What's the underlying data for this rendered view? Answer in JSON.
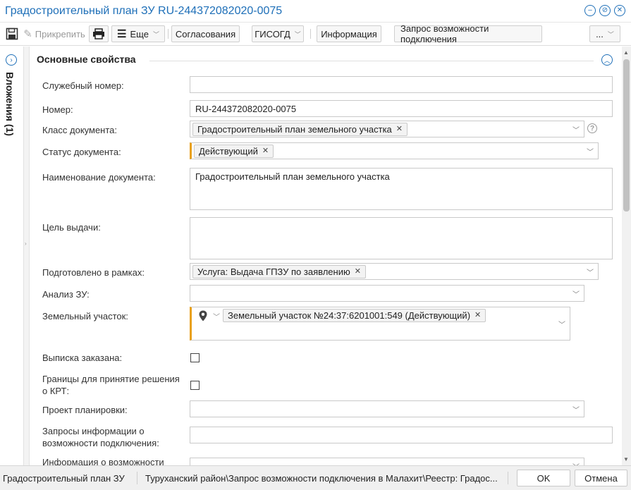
{
  "window": {
    "title": "Градостроительный план ЗУ RU-244372082020-0075",
    "buttons": [
      "minimize",
      "pin",
      "close"
    ]
  },
  "toolbar": {
    "attach_label": "Прикрепить",
    "more_label": "Еще",
    "approvals_label": "Согласования",
    "gisogd_label": "ГИСОГД",
    "info_label": "Информация",
    "connection_label": "Запрос возможности подключения",
    "overflow_label": "..."
  },
  "sidebar": {
    "label": "Вложения (1)"
  },
  "section": {
    "title": "Основные свойства"
  },
  "form": {
    "service_number": {
      "label": "Служебный номер:",
      "value": ""
    },
    "number": {
      "label": "Номер:",
      "value": "RU-244372082020-0075"
    },
    "doc_class": {
      "label": "Класс документа:",
      "tag": "Градостроительный план земельного участка"
    },
    "doc_status": {
      "label": "Статус документа:",
      "tag": "Действующий"
    },
    "doc_name": {
      "label": "Наименование документа:",
      "value": "Градостроительный план земельного участка"
    },
    "purpose": {
      "label": "Цель выдачи:",
      "value": ""
    },
    "prepared_within": {
      "label": "Подготовлено в рамках:",
      "tag": "Услуга: Выдача ГПЗУ по заявлению"
    },
    "analysis": {
      "label": "Анализ ЗУ:",
      "value": ""
    },
    "land_plot": {
      "label": "Земельный участок:",
      "tag": "Земельный участок №24:37:6201001:549 (Действующий)"
    },
    "extract_ordered": {
      "label": "Выписка заказана:",
      "checked": false
    },
    "krt_boundaries": {
      "label": "Границы для принятие решения о КРТ:",
      "checked": false
    },
    "planning_project": {
      "label": "Проект планировки:",
      "value": ""
    },
    "connection_requests": {
      "label": "Запросы информации о возможности подключения:",
      "value": ""
    },
    "connection_info": {
      "label": "Информация о возможности"
    }
  },
  "statusbar": {
    "doc_type": "Градостроительный план ЗУ",
    "path": "Туруханский район\\Запрос возможности подключения в Малахит\\Реестр: Градос...",
    "ok_label": "OK",
    "cancel_label": "Отмена"
  },
  "colors": {
    "accent": "#1e6fb8",
    "required_marker": "#e8a01a"
  }
}
